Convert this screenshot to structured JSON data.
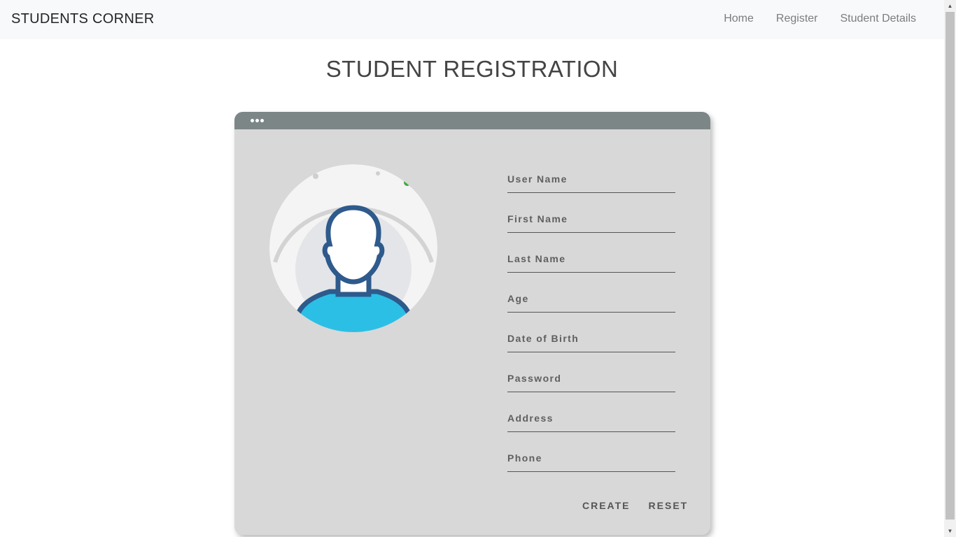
{
  "navbar": {
    "brand": "STUDENTS CORNER",
    "links": [
      "Home",
      "Register",
      "Student Details"
    ]
  },
  "page": {
    "title": "STUDENT REGISTRATION"
  },
  "form": {
    "fields": [
      {
        "placeholder": "User Name",
        "value": ""
      },
      {
        "placeholder": "First Name",
        "value": ""
      },
      {
        "placeholder": "Last Name",
        "value": ""
      },
      {
        "placeholder": "Age",
        "value": ""
      },
      {
        "placeholder": "Date of Birth",
        "value": ""
      },
      {
        "placeholder": "Password",
        "value": ""
      },
      {
        "placeholder": "Address",
        "value": ""
      },
      {
        "placeholder": "Phone",
        "value": ""
      }
    ],
    "create_label": "CREATE",
    "reset_label": "RESET"
  },
  "colors": {
    "card_background": "#d8d8d8",
    "card_header": "#7c8687",
    "avatar_outline": "#2e5a8c",
    "avatar_shirt": "#2cbfe6"
  },
  "icons": {
    "avatar": "user-silhouette-icon",
    "window_dots": "window-dots-icon",
    "scroll_up": "arrow-up-icon",
    "scroll_down": "arrow-down-icon"
  }
}
